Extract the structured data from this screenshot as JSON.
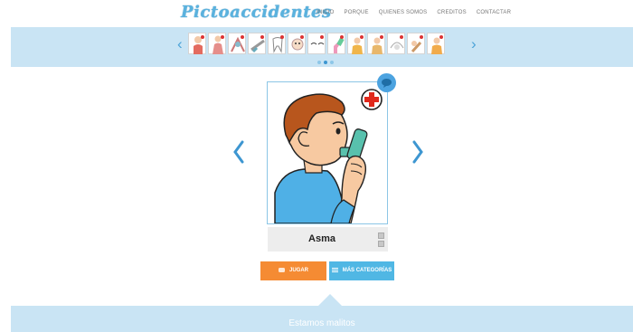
{
  "header": {
    "logo_text": "Pictoaccidentes",
    "nav": [
      "INICIO",
      "PORQUE",
      "QUIENES SOMOS",
      "CREDITOS",
      "CONTACTAR"
    ]
  },
  "carousel": {
    "prev_icon": "chevron-left-icon",
    "next_icon": "chevron-right-icon",
    "prev_glyph": "‹",
    "next_glyph": "›",
    "thumbnail_count": 13,
    "page_dots": 3,
    "active_dot": 1
  },
  "card": {
    "title": "Asma",
    "illustration": "boy-using-inhaler",
    "badge_icon": "red-cross-icon"
  },
  "buttons": {
    "play": "JUGAR",
    "categories": "MÁS CATEGORÍAS"
  },
  "footer": {
    "text": "Estamos malitos"
  },
  "colors": {
    "accent_blue": "#4ca3d8",
    "band": "#c9e4f4",
    "orange": "#f58b33",
    "light_blue": "#50b7e4"
  }
}
